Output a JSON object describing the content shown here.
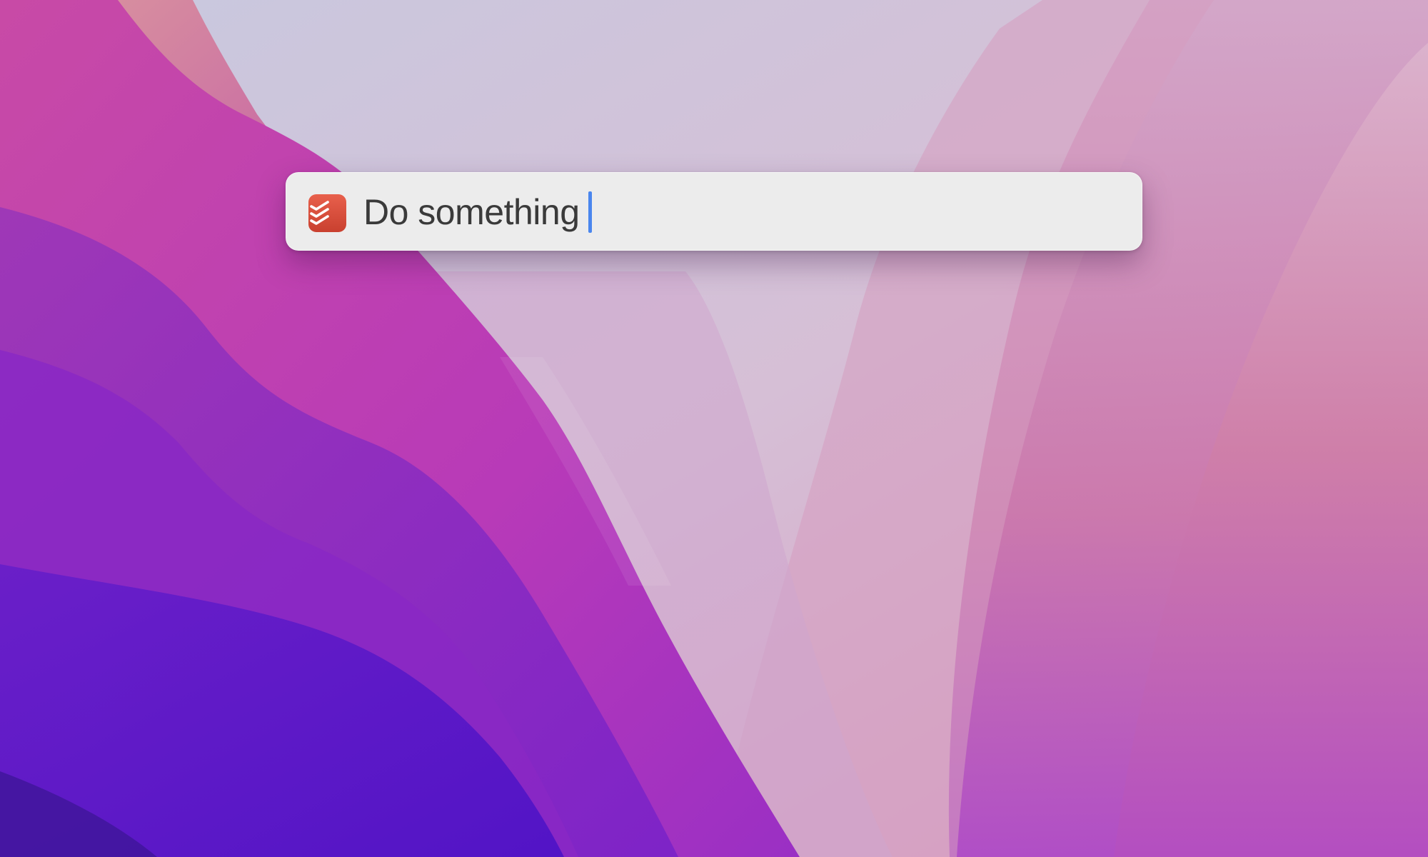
{
  "desktop": {
    "wallpaper": "abstract-purple-pink-waves"
  },
  "quick_add": {
    "app_icon": "todoist-icon",
    "input_value": "Do something",
    "caret_color": "#4a86ee",
    "icon_color": "#db4c3f"
  }
}
